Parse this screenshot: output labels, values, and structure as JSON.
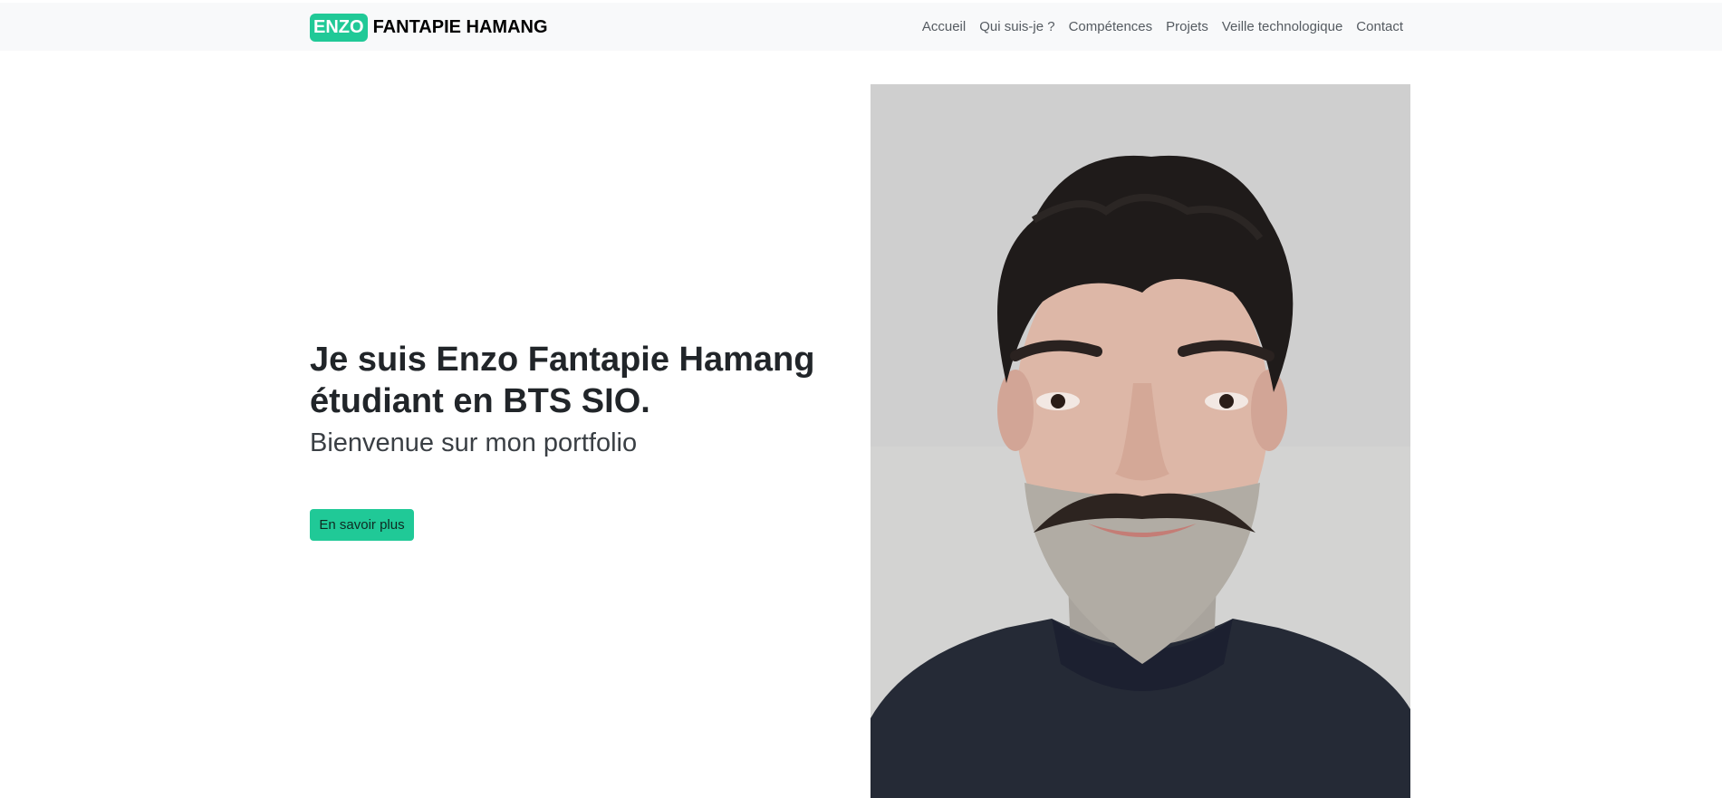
{
  "brand": {
    "badge": "ENZO",
    "name": "FANTAPIE HAMANG"
  },
  "nav": {
    "items": [
      "Accueil",
      "Qui suis-je ?",
      "Compétences",
      "Projets",
      "Veille technologique",
      "Contact"
    ]
  },
  "hero": {
    "title_line1": "Je suis Enzo Fantapie Hamang",
    "title_line2": "étudiant en BTS SIO.",
    "subtitle": "Bienvenue sur mon portfolio",
    "cta_label": "En savoir plus"
  },
  "colors": {
    "accent": "#20c997",
    "navbar_bg": "#f8f9fa",
    "text": "#212529"
  }
}
